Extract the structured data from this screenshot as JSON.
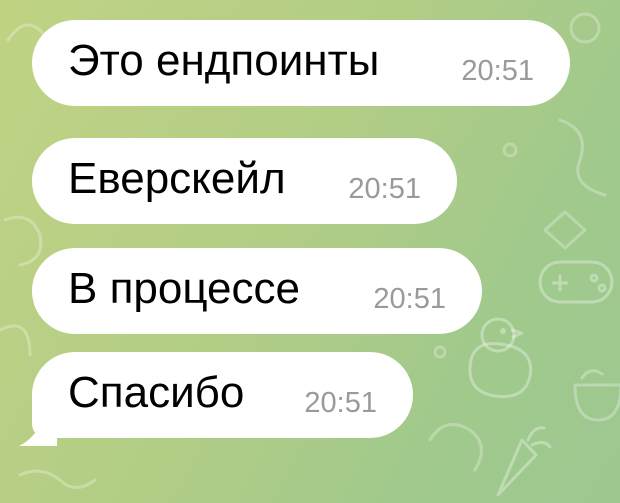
{
  "chat": {
    "messages": [
      {
        "text": "Это ендпоинты",
        "time": "20:51"
      },
      {
        "text": "Еверскейл",
        "time": "20:51"
      },
      {
        "text": "В процессе",
        "time": "20:51"
      },
      {
        "text": "Спасибо",
        "time": "20:51"
      }
    ]
  },
  "colors": {
    "bubble": "#ffffff",
    "message_text": "#000000",
    "timestamp": "#9a9a9a",
    "wallpaper_start": "#c0d383",
    "wallpaper_end": "#9cc890"
  },
  "icons": [
    "chick-doodle-icon",
    "gamepad-doodle-icon",
    "carrot-doodle-icon",
    "doodle-pattern"
  ]
}
